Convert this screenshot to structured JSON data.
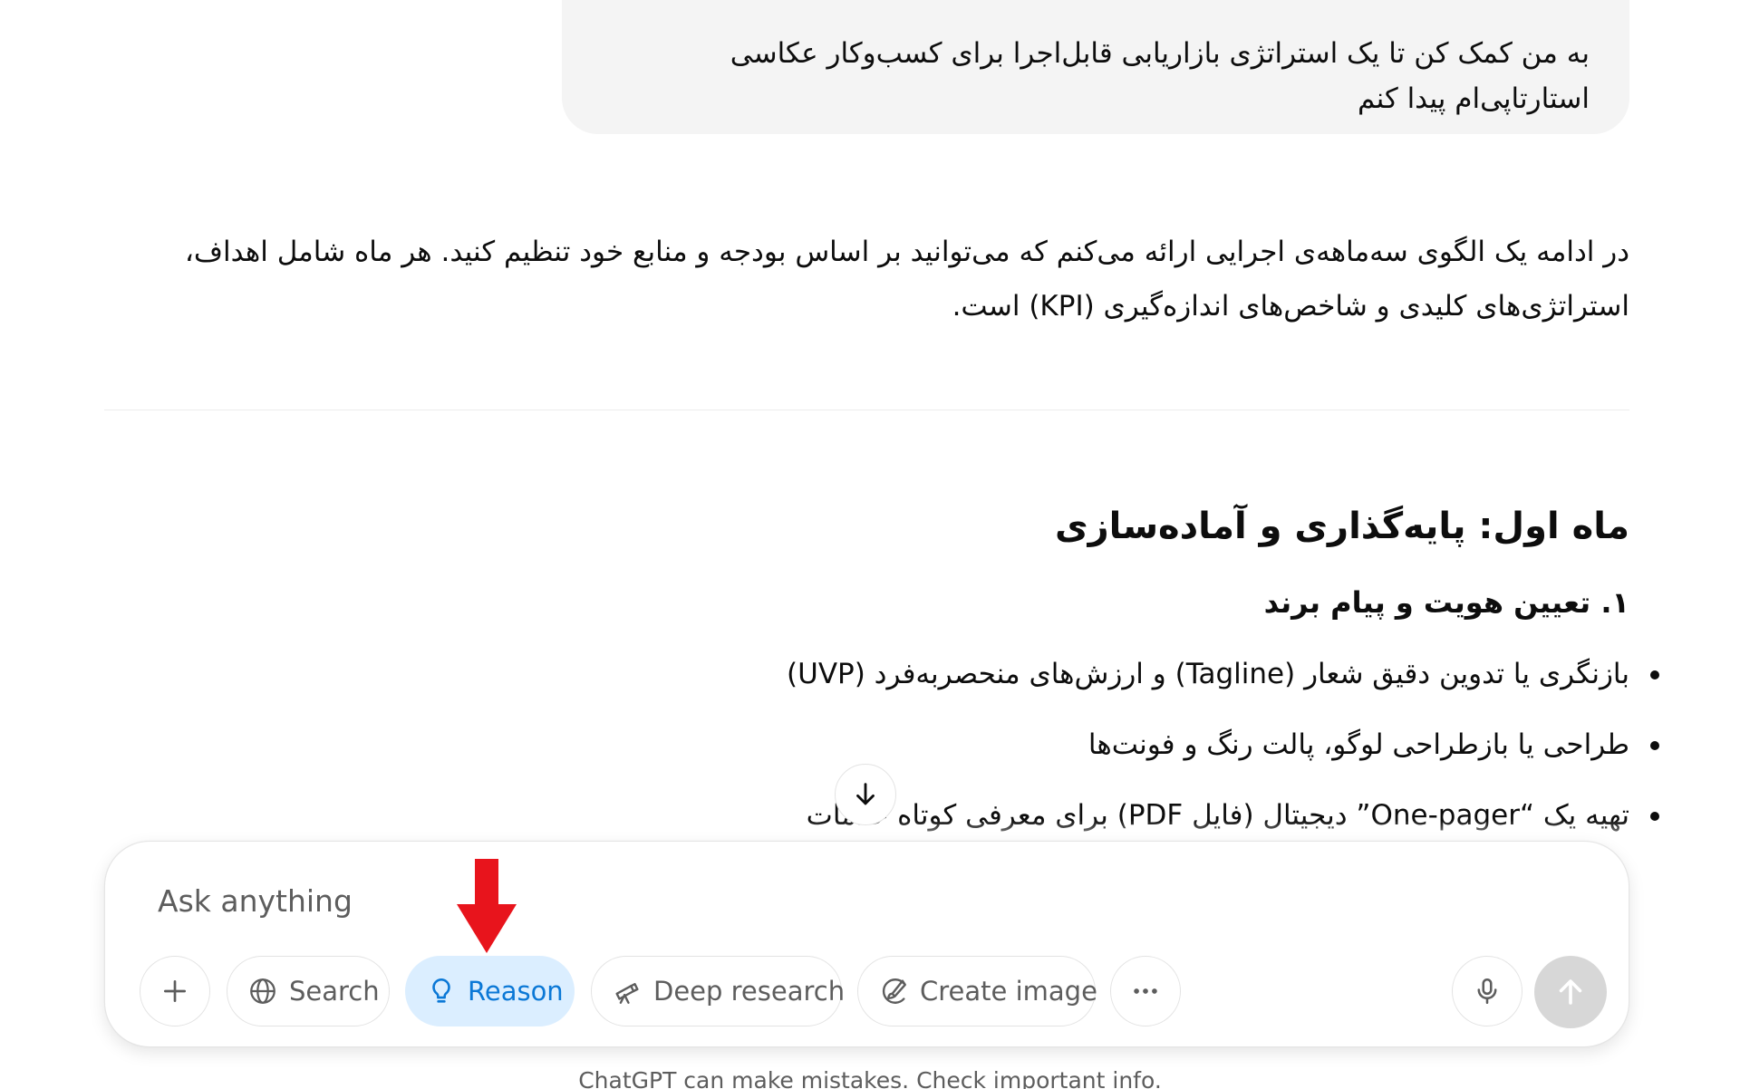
{
  "user_message": {
    "text": "به من کمک کن تا یک استراتژی بازاریابی قابل‌اجرا برای کسب‌وکار عکاسی استارتاپی‌ام پیدا کنم"
  },
  "assistant": {
    "intro": "در ادامه یک الگوی سه‌ماهه‌ی اجرایی ارائه می‌کنم که می‌توانید بر اساس بودجه و منابع خود تنظیم کنید. هر ماه شامل اهداف، استراتژی‌های کلیدی و شاخص‌های اندازه‌گیری (KPI) است.",
    "section_title": "ماه اول: پایه‌گذاری و آماده‌سازی",
    "subsection_title": "۱. تعیین هویت و پیام برند",
    "bullets": [
      "بازنگری یا تدوین دقیق شعار (Tagline) و ارزش‌های منحصربه‌فرد (UVP)",
      "طراحی یا بازطراحی لوگو، پالت رنگ و فونت‌ها",
      "تهیه یک “One-pager” دیجیتال (فایل PDF) برای معرفی کوتاه خدمات"
    ]
  },
  "composer": {
    "placeholder": "Ask anything",
    "buttons": {
      "search": "Search",
      "reason": "Reason",
      "deep_research": "Deep research",
      "create_image": "Create image"
    },
    "icons": {
      "plus": "plus-icon",
      "search": "globe-icon",
      "reason": "lightbulb-icon",
      "deep_research": "telescope-icon",
      "create_image": "paint-brush-icon",
      "more": "ellipsis-icon",
      "mic": "microphone-icon",
      "send": "arrow-up-icon",
      "scroll": "arrow-down-icon"
    },
    "reason_active": true
  },
  "annotation": {
    "type": "red-arrow-pointing-down",
    "color": "#e8141c"
  },
  "footer": {
    "disclaimer": "ChatGPT can make mistakes. Check important info."
  },
  "colors": {
    "accent_blue": "#0b78d6",
    "accent_blue_bg": "#dbeeff",
    "bubble_bg": "#f4f4f4",
    "send_disabled": "#d7d7d7"
  }
}
